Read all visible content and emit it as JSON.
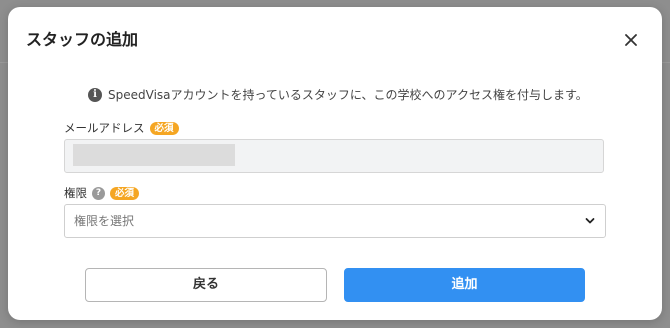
{
  "modal": {
    "title": "スタッフの追加",
    "close_icon": "close-icon"
  },
  "info": {
    "icon": "info-icon",
    "icon_glyph": "i",
    "text": "SpeedVisaアカウントを持っているスタッフに、この学校へのアクセス権を付与します。"
  },
  "form": {
    "email": {
      "label": "メールアドレス",
      "required_badge": "必須",
      "value_redacted": true
    },
    "permission": {
      "label": "権限",
      "help_icon": "question-icon",
      "help_glyph": "?",
      "required_badge": "必須",
      "placeholder": "権限を選択",
      "chevron_icon": "chevron-down-icon"
    }
  },
  "actions": {
    "back_label": "戻る",
    "add_label": "追加"
  },
  "colors": {
    "primary": "#3290f2",
    "required_badge": "#f5a623",
    "backdrop": "#8e8e8e"
  }
}
